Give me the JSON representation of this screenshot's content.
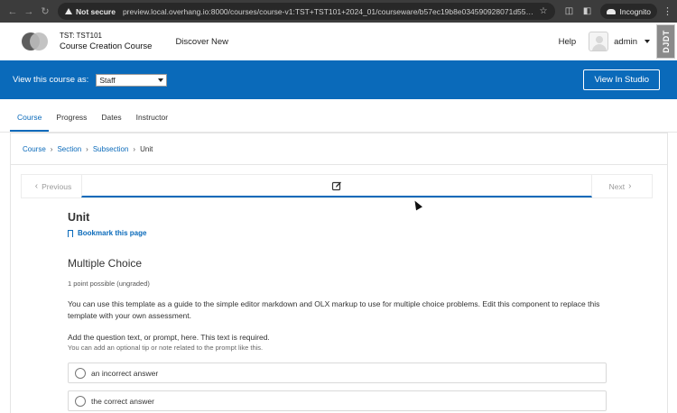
{
  "browser": {
    "security_label": "Not secure",
    "url": "preview.local.overhang.io:8000/courses/course-v1:TST+TST101+2024_01/courseware/b57ec19b8e034590928071d553e9ec37/6...",
    "incognito_label": "Incognito"
  },
  "header": {
    "course_code": "TST: TST101",
    "course_title": "Course Creation Course",
    "discover": "Discover New",
    "help": "Help",
    "username": "admin",
    "debug_toolbar": "DJDT"
  },
  "staff_bar": {
    "label": "View this course as:",
    "selected": "Staff",
    "studio_button": "View In Studio"
  },
  "tabs": [
    {
      "label": "Course",
      "active": true
    },
    {
      "label": "Progress",
      "active": false
    },
    {
      "label": "Dates",
      "active": false
    },
    {
      "label": "Instructor",
      "active": false
    }
  ],
  "breadcrumb": {
    "course": "Course",
    "section": "Section",
    "subsection": "Subsection",
    "current": "Unit"
  },
  "sequence_nav": {
    "previous": "Previous",
    "next": "Next"
  },
  "unit": {
    "title": "Unit",
    "bookmark": "Bookmark this page"
  },
  "problem": {
    "title": "Multiple Choice",
    "points": "1 point possible (ungraded)",
    "description": "You can use this template as a guide to the simple editor markdown and OLX markup to use for multiple choice problems. Edit this component to replace this template with your own assessment.",
    "prompt": "Add the question text, or prompt, here. This text is required.",
    "tip": "You can add an optional tip or note related to the prompt like this.",
    "choices": [
      "an incorrect answer",
      "the correct answer"
    ]
  }
}
